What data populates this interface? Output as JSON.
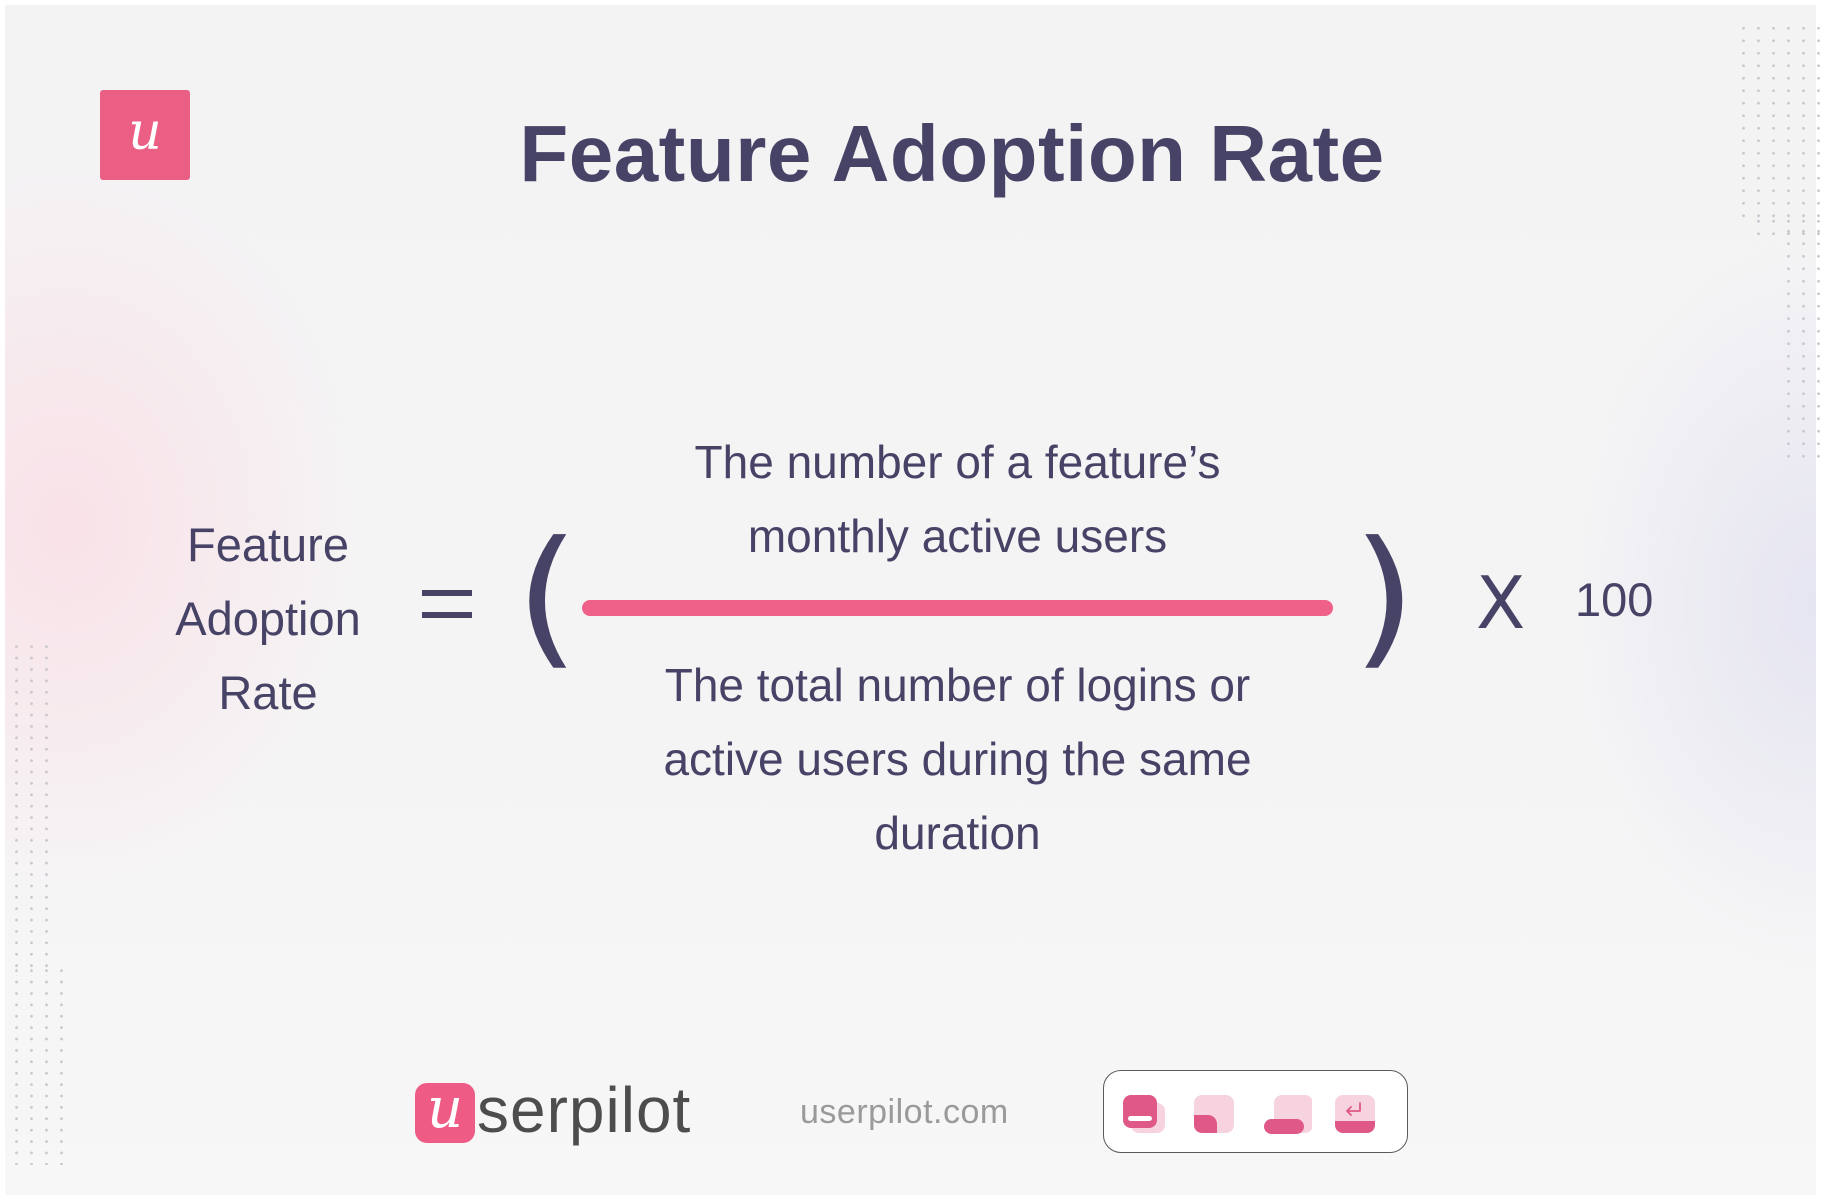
{
  "header": {
    "logo_letter": "u",
    "title": "Feature Adoption Rate"
  },
  "formula": {
    "lhs_lines": [
      "Feature",
      "Adoption",
      "Rate"
    ],
    "equals": "=",
    "paren_open": "(",
    "paren_close": ")",
    "numerator_lines": [
      "The number of a feature’s",
      "monthly active users"
    ],
    "denominator_lines": [
      "The total number of logins or",
      "active users during the same",
      "duration"
    ],
    "times": "X",
    "multiplier": "100"
  },
  "footer": {
    "brand_mark_letter": "u",
    "brand_name": "serpilot",
    "website": "userpilot.com",
    "icons": [
      {
        "name": "modal-icon"
      },
      {
        "name": "slideout-icon"
      },
      {
        "name": "banner-icon"
      },
      {
        "name": "enter-key-icon"
      }
    ]
  },
  "colors": {
    "text_primary": "#474366",
    "accent_pink": "#ec5f85",
    "accent_pink_light": "#f7d3e0",
    "brand_gray": "#4d4d4d",
    "url_gray": "#9a9a9a"
  }
}
